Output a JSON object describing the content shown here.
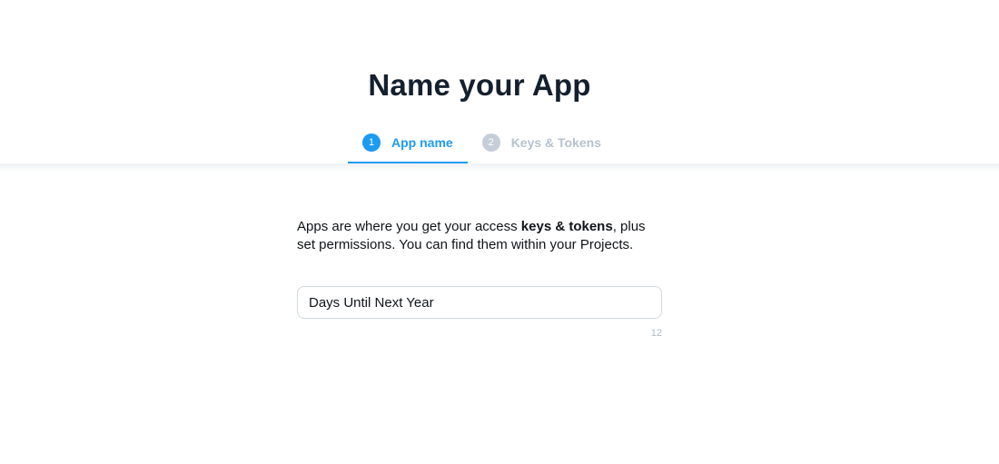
{
  "page": {
    "title": "Name your App"
  },
  "steps": [
    {
      "number": "1",
      "label": "App name",
      "active": true
    },
    {
      "number": "2",
      "label": "Keys & Tokens",
      "active": false
    }
  ],
  "form": {
    "description_part1": "Apps are where you get your access ",
    "description_bold": "keys & tokens",
    "description_part2": ", plus set permissions. You can find them within your Projects.",
    "app_name_value": "Days Until Next Year",
    "char_count": "12"
  },
  "colors": {
    "accent": "#1d9bf0",
    "inactive_step": "#b6c2cf",
    "title": "#14202e"
  }
}
